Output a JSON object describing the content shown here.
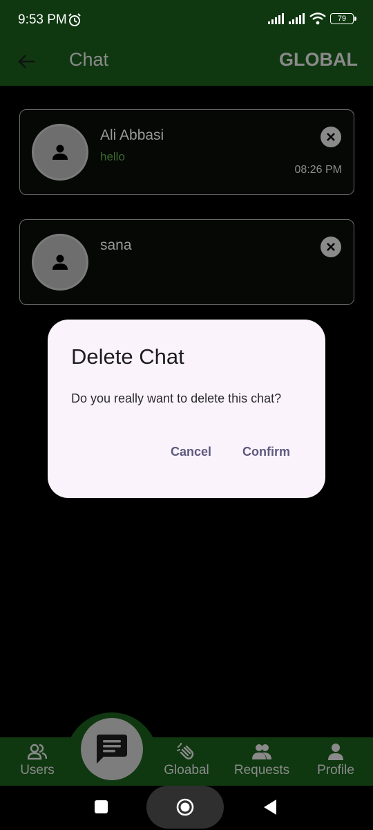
{
  "status_bar": {
    "time": "9:53 PM",
    "battery": "79"
  },
  "app_bar": {
    "title": "Chat",
    "action": "GLOBAL"
  },
  "chats": [
    {
      "name": "Ali Abbasi",
      "message": "hello",
      "time": "08:26 PM"
    },
    {
      "name": "sana",
      "message": "",
      "time": ""
    }
  ],
  "dialog": {
    "title": "Delete Chat",
    "body": "Do you really want to delete this chat?",
    "cancel": "Cancel",
    "confirm": "Confirm"
  },
  "bottom_nav": {
    "users": "Users",
    "global": "Gloabal",
    "requests": "Requests",
    "profile": "Profile"
  },
  "colors": {
    "bar_green": "#0f3810",
    "dialog_bg": "#fbf3fb",
    "accent_text": "#5d5a7e"
  }
}
